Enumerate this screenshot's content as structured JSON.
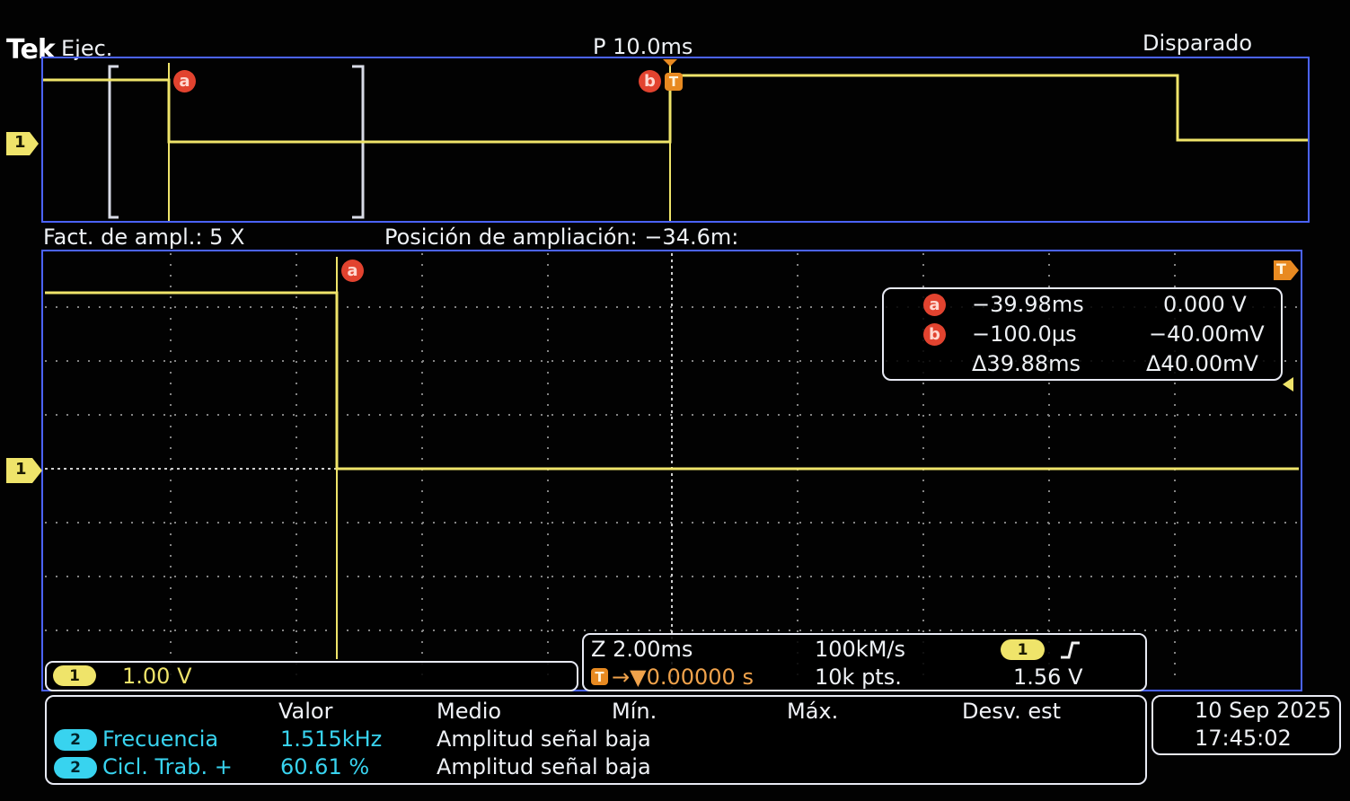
{
  "header": {
    "brand": "Tek",
    "mode": "Ejec.",
    "timebase": "P 10.0ms",
    "trigger_status": "Disparado"
  },
  "top_overview": {
    "channel_marker": "1",
    "cursor_a": "a",
    "cursor_b": "b",
    "trigger_marker": "T"
  },
  "zoom_info": {
    "factor": "Fact. de ampl.: 5 X",
    "position": "Posición de ampliación: −34.6m:"
  },
  "main_scope": {
    "channel_marker": "1",
    "cursor_a": "a",
    "trigger_marker": "T"
  },
  "cursor_readout": {
    "a": {
      "label": "a",
      "time": "−39.98ms",
      "value": "0.000 V"
    },
    "b": {
      "label": "b",
      "time": "−100.0µs",
      "value": "−40.00mV"
    },
    "delta": {
      "time": "Δ39.88ms",
      "value": "Δ40.00mV"
    }
  },
  "channel_scale": {
    "channel": "1",
    "value": "1.00 V"
  },
  "acquisition": {
    "zoom": "Z 2.00ms",
    "delay": "→▼0.00000 s",
    "trigger_marker": "T",
    "sample_rate": "100kM/s",
    "record_length": "10k pts.",
    "trigger_channel": "1",
    "trigger_slope_icon": "rising-edge-icon",
    "trigger_level": "1.56 V"
  },
  "measurements": {
    "headers": [
      "Valor",
      "Medio",
      "Mín.",
      "Máx.",
      "Desv. est"
    ],
    "rows": [
      {
        "channel": "2",
        "name": "Frecuencia",
        "value": "1.515kHz",
        "mean": "Amplitud señal baja"
      },
      {
        "channel": "2",
        "name": "Cicl. Trab. +",
        "value": "60.61 %",
        "mean": "Amplitud señal baja"
      }
    ]
  },
  "datetime": {
    "date": "10 Sep 2025",
    "time": "17:45:02"
  },
  "colors": {
    "trace": "#efe46a",
    "border_blue": "#4b63ff",
    "cursor_red": "#e2432f",
    "trigger_orange": "#e88a21",
    "channel2": "#38d3ef"
  }
}
